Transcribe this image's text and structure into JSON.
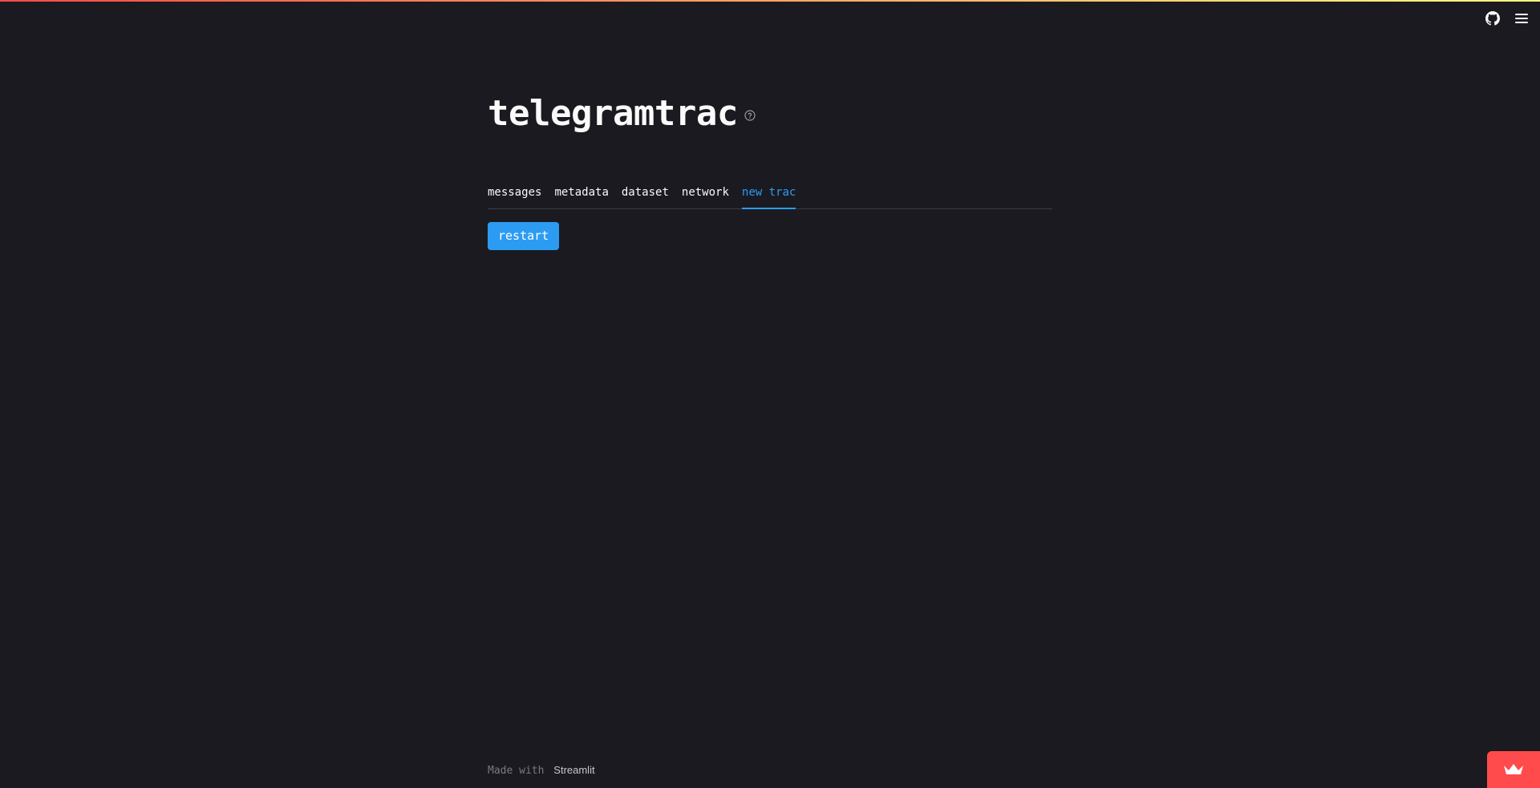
{
  "app": {
    "title": "telegramtrac",
    "accent_color": "#2c9cf3",
    "background_color": "#1b1a20"
  },
  "toolbar": {
    "github_icon": "github-icon",
    "menu_icon": "hamburger-menu-icon"
  },
  "tabs": [
    {
      "label": "messages",
      "active": false
    },
    {
      "label": "metadata",
      "active": false
    },
    {
      "label": "dataset",
      "active": false
    },
    {
      "label": "network",
      "active": false
    },
    {
      "label": "new trac",
      "active": true
    }
  ],
  "actions": {
    "restart_label": "restart"
  },
  "footer": {
    "prefix": "Made with",
    "brand": "Streamlit"
  }
}
